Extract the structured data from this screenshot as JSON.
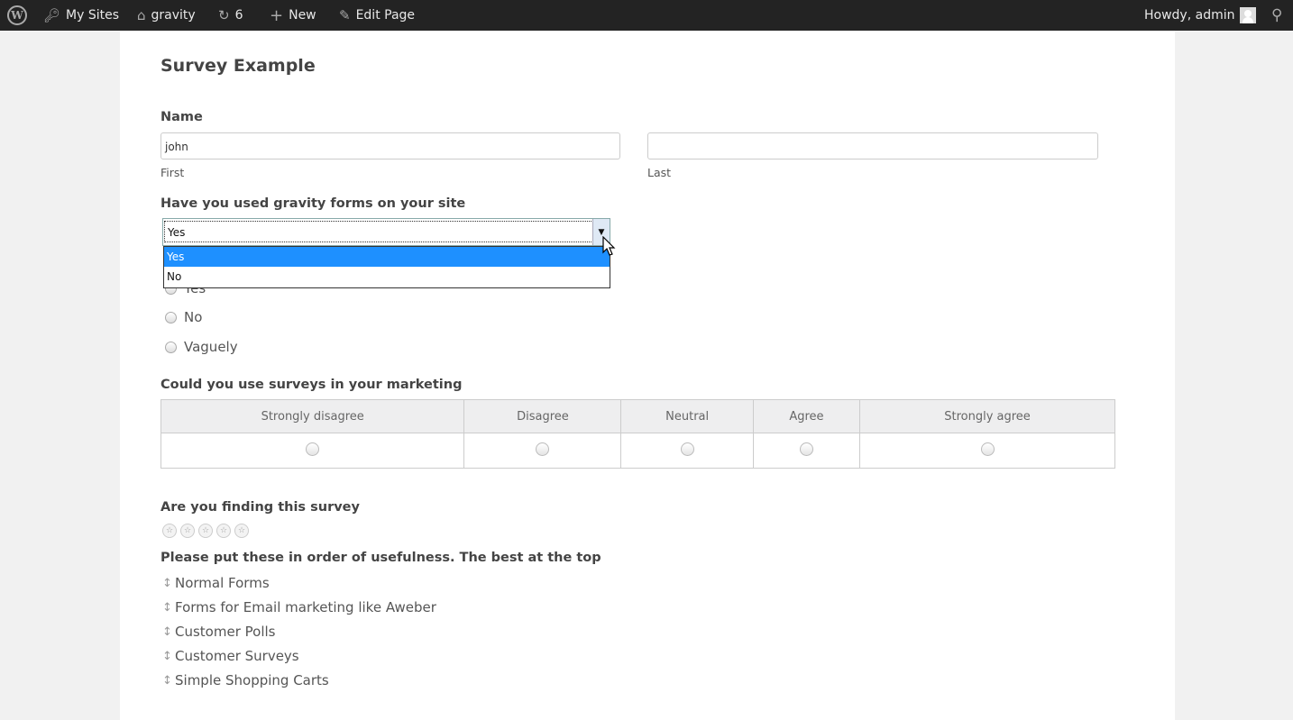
{
  "admin_bar": {
    "wp_logo": "wordpress-logo",
    "my_sites": "My Sites",
    "site_name": "gravity",
    "updates_count": "6",
    "new_label": "New",
    "edit_page": "Edit Page",
    "greeting": "Howdy, admin"
  },
  "page": {
    "title": "Survey Example"
  },
  "form": {
    "name": {
      "label": "Name",
      "first_value": "john",
      "first_sublabel": "First",
      "last_value": "",
      "last_sublabel": "Last"
    },
    "used_gf": {
      "label": "Have you used gravity forms on your site",
      "selected": "Yes",
      "options": [
        "Yes",
        "No"
      ],
      "highlighted_option": "Yes"
    },
    "radio_question": {
      "options": [
        "Yes",
        "No",
        "Vaguely"
      ]
    },
    "likert": {
      "label": "Could you use surveys in your marketing",
      "columns": [
        "Strongly disagree",
        "Disagree",
        "Neutral",
        "Agree",
        "Strongly agree"
      ]
    },
    "rating": {
      "label": "Are you finding this survey",
      "max_stars": 5,
      "value": 0
    },
    "rank": {
      "label": "Please put these in order of usefulness. The best at the top",
      "items": [
        "Normal Forms",
        "Forms for Email marketing like Aweber",
        "Customer Polls",
        "Customer Surveys",
        "Simple Shopping Carts"
      ]
    }
  }
}
